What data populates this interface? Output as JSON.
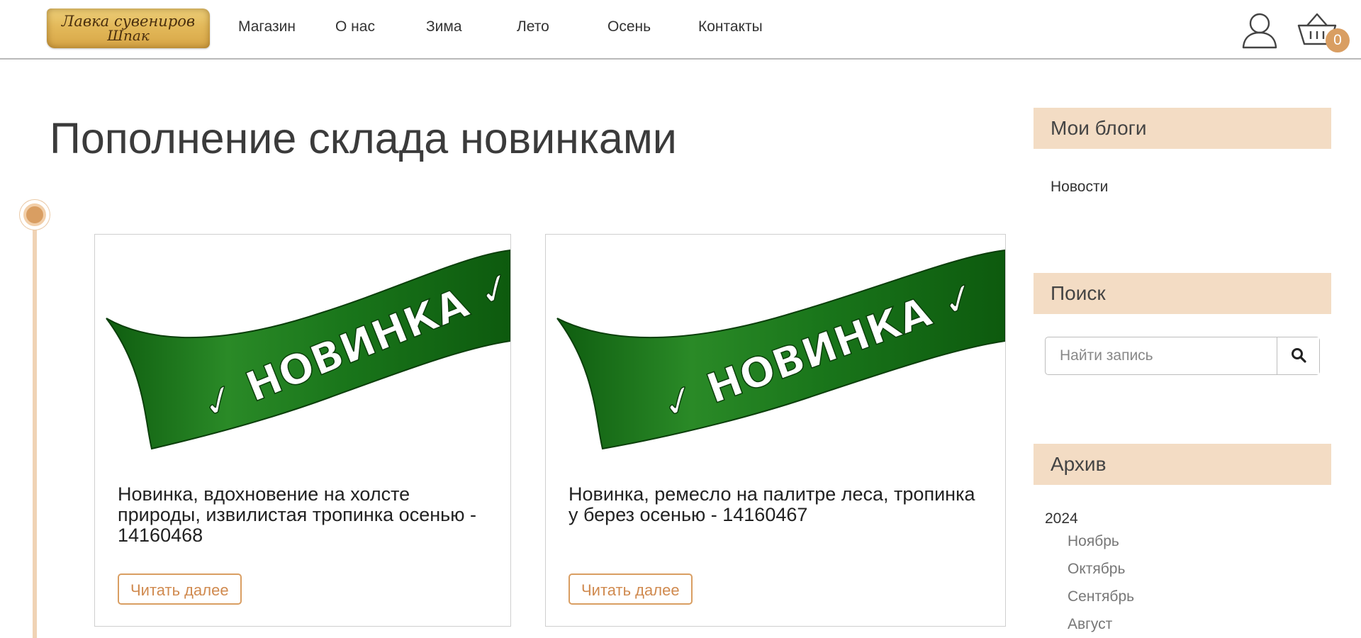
{
  "header": {
    "logo_line1": "Лавка сувениров",
    "logo_line2": "Шпак",
    "nav": [
      "Магазин",
      "О нас",
      "Зима",
      "Лето",
      "Осень",
      "Контакты"
    ],
    "cart_count": "0",
    "icons": {
      "account": "user-icon",
      "cart": "basket-icon"
    }
  },
  "main": {
    "title": "Пополнение склада новинками",
    "posts": [
      {
        "banner_text": "✓ НОВИНКА ✓",
        "title": "Новинка, вдохновение на холсте природы, извилистая тропинка осенью - 14160468",
        "read_more": "Читать далее"
      },
      {
        "banner_text": "✓ НОВИНКА ✓",
        "title": "Новинка, ремесло на палитре леса, тропинка у берез осенью - 14160467",
        "read_more": "Читать далее"
      }
    ]
  },
  "sidebar": {
    "blogs": {
      "title": "Мои блоги",
      "items": [
        "Новости"
      ]
    },
    "search": {
      "title": "Поиск",
      "placeholder": "Найти запись"
    },
    "archive": {
      "title": "Архив",
      "year": "2024",
      "months": [
        "Ноябрь",
        "Октябрь",
        "Сентябрь",
        "Август"
      ]
    }
  },
  "colors": {
    "accent": "#d99e62",
    "widget_bg": "#f3dcc4",
    "timeline": "#f0d3b5",
    "banner_green": "#1f7a1f"
  }
}
